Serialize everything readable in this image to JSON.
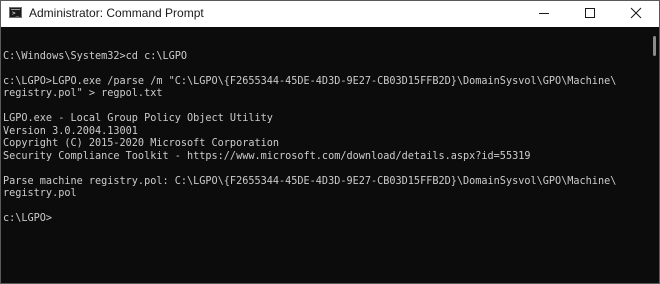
{
  "window": {
    "title": "Administrator: Command Prompt",
    "app_icon": "cmd-icon"
  },
  "title_controls": {
    "minimize_icon": "minimize-icon",
    "maximize_icon": "maximize-icon",
    "close_icon": "close-icon"
  },
  "console": {
    "lines": [
      "",
      "C:\\Windows\\System32>cd c:\\LGPO",
      "",
      "c:\\LGPO>LGPO.exe /parse /m \"C:\\LGPO\\{F2655344-45DE-4D3D-9E27-CB03D15FFB2D}\\DomainSysvol\\GPO\\Machine\\",
      "registry.pol\" > regpol.txt",
      "",
      "LGPO.exe - Local Group Policy Object Utility",
      "Version 3.0.2004.13001",
      "Copyright (C) 2015-2020 Microsoft Corporation",
      "Security Compliance Toolkit - https://www.microsoft.com/download/details.aspx?id=55319",
      "",
      "Parse machine registry.pol: C:\\LGPO\\{F2655344-45DE-4D3D-9E27-CB03D15FFB2D}\\DomainSysvol\\GPO\\Machine\\",
      "registry.pol",
      "",
      "c:\\LGPO>"
    ]
  },
  "colors": {
    "console_background": "#0c0c0c",
    "console_text": "#cccccc",
    "titlebar_background": "#ffffff"
  }
}
